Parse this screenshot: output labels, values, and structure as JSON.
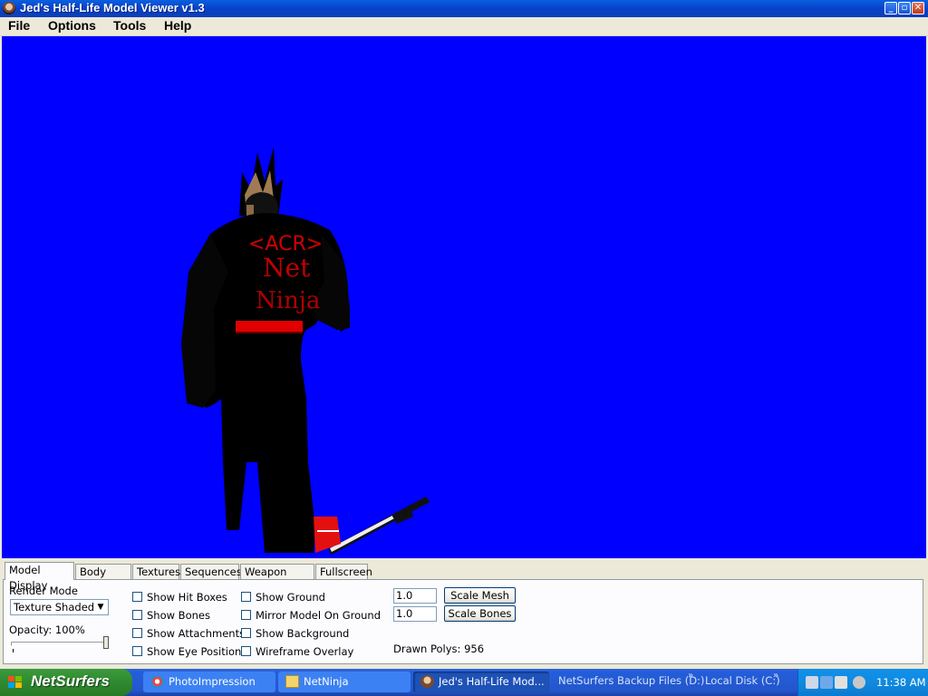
{
  "window": {
    "title": "Jed's Half-Life Model Viewer v1.3"
  },
  "menu": [
    "File",
    "Options",
    "Tools",
    "Help"
  ],
  "model_text": {
    "line1": "<ACR>",
    "line2": "Net",
    "line3": "Ninja"
  },
  "tabs": [
    "Model Display",
    "Body Parts",
    "Textures",
    "Sequences",
    "Weapon Origin",
    "Fullscreen"
  ],
  "panel": {
    "render_mode_label": "Render Mode",
    "render_mode_value": "Texture Shaded",
    "opacity_label": "Opacity: 100%",
    "opacity_value": 100,
    "checkboxes_col1": [
      "Show Hit Boxes",
      "Show Bones",
      "Show Attachments",
      "Show Eye Position"
    ],
    "checkboxes_col2": [
      "Show Ground",
      "Mirror Model On Ground",
      "Show Background",
      "Wireframe Overlay"
    ],
    "scale_mesh_value": "1.0",
    "scale_bones_value": "1.0",
    "scale_mesh_button": "Scale Mesh",
    "scale_bones_button": "Scale Bones",
    "drawn_polys": "Drawn Polys: 956"
  },
  "taskbar": {
    "start_label": "NetSurfers",
    "tasks": [
      "PhotoImpression",
      "NetNinja",
      "Jed's Half-Life Mod..."
    ],
    "quick": [
      "NetSurfers Backup Files (D:)",
      "Local Disk (C:)"
    ],
    "clock": "11:38 AM"
  },
  "colors": {
    "viewport_bg": "#0000ff",
    "titlebar": "#0842c8",
    "start_green": "#2f8a2f"
  }
}
